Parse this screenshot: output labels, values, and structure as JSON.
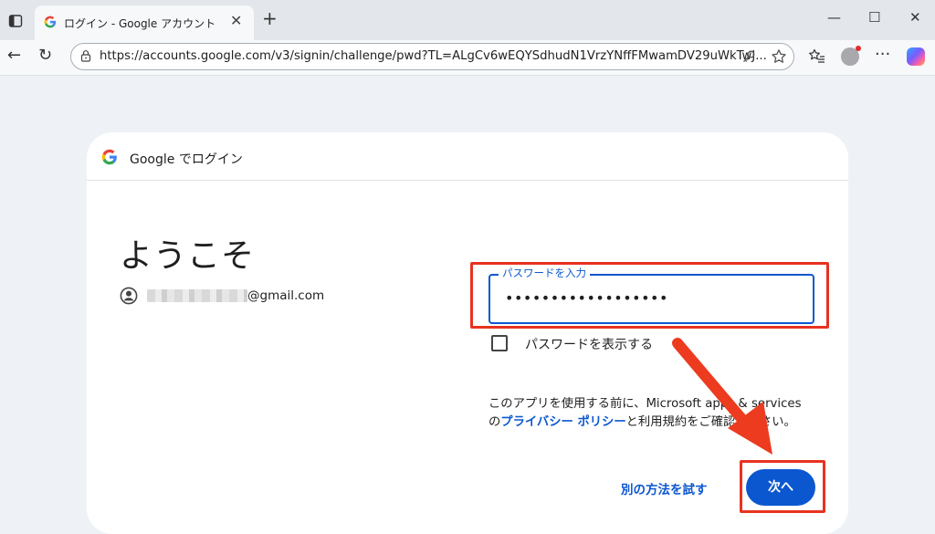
{
  "browser": {
    "tab_title": "ログイン - Google アカウント",
    "tab_close": "✕",
    "new_tab": "+",
    "url": "https://accounts.google.com/v3/signin/challenge/pwd?TL=ALgCv6wEQYSdhudN1VrzYNffFMwamDV29uWkTwJ...",
    "window_controls": {
      "minimize": "—",
      "maximize": "☐",
      "close": "✕"
    },
    "nav": {
      "back": "←",
      "reload": "↻"
    },
    "menu": "···"
  },
  "card": {
    "header_text": "Google でログイン",
    "welcome": "ようこそ",
    "account_email_suffix": "@gmail.com",
    "password_label": "パスワードを入力",
    "password_value": "••••••••••••••••••",
    "show_password_label": "パスワードを表示する",
    "legal_prefix": "このアプリを使用する前に、Microsoft apps & services の",
    "legal_link": "プライバシー ポリシー",
    "legal_suffix": "と利用規約をご確認ください。",
    "try_another_way": "別の方法を試す",
    "next_button": "次へ"
  },
  "colors": {
    "accent": "#0b57d0",
    "annotation_red": "#e8321f",
    "page_bg": "#eef1f6"
  },
  "icons": [
    "sidebar-toggle-icon",
    "google-g-icon",
    "lock-icon",
    "key-icon",
    "star-icon",
    "favorites-icon",
    "avatar",
    "copilot-icon",
    "account-circle-icon"
  ]
}
